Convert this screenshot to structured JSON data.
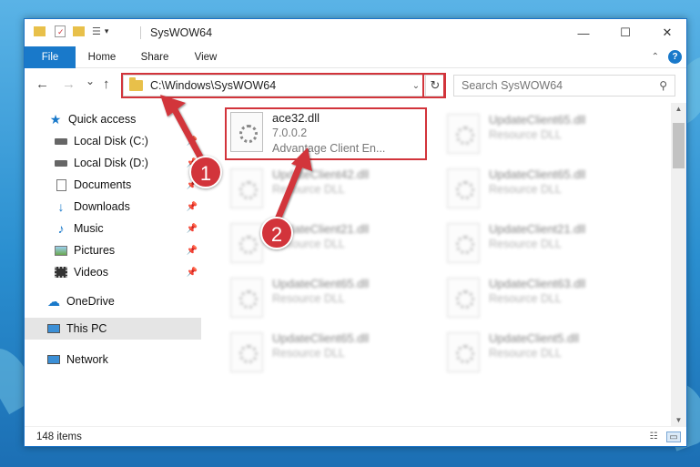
{
  "window": {
    "title": "SysWOW64",
    "minimize_glyph": "—",
    "maximize_glyph": "☐",
    "close_glyph": "✕"
  },
  "ribbon": {
    "tabs": [
      {
        "label": "File",
        "active": true
      },
      {
        "label": "Home"
      },
      {
        "label": "Share"
      },
      {
        "label": "View"
      }
    ],
    "help_glyph": "?",
    "collapse_glyph": "⌃"
  },
  "navigation": {
    "back_glyph": "←",
    "forward_glyph": "→",
    "recent_glyph": "⌄",
    "up_glyph": "↑",
    "address_path": "C:\\Windows\\SysWOW64",
    "address_dropdown_glyph": "⌄",
    "refresh_glyph": "↻",
    "search_placeholder": "Search SysWOW64",
    "search_icon": "magnifier-icon"
  },
  "sidebar": {
    "items": [
      {
        "label": "Quick access",
        "icon": "star-icon"
      },
      {
        "label": "Local Disk (C:)",
        "icon": "drive-icon",
        "pinned": true
      },
      {
        "label": "Local Disk (D:)",
        "icon": "drive-icon",
        "pinned": true
      },
      {
        "label": "Documents",
        "icon": "documents-icon",
        "pinned": true
      },
      {
        "label": "Downloads",
        "icon": "download-icon",
        "pinned": true
      },
      {
        "label": "Music",
        "icon": "music-icon",
        "pinned": true
      },
      {
        "label": "Pictures",
        "icon": "pictures-icon",
        "pinned": true
      },
      {
        "label": "Videos",
        "icon": "videos-icon",
        "pinned": true
      },
      {
        "label": "OneDrive",
        "icon": "cloud-icon"
      },
      {
        "label": "This PC",
        "icon": "computer-icon",
        "selected": true
      },
      {
        "label": "Network",
        "icon": "network-icon"
      }
    ]
  },
  "files": {
    "left_column": [
      {
        "name": "ace32.dll",
        "line2": "7.0.0.2",
        "line3": "Advantage Client En...",
        "selected": true
      },
      {
        "name": "UpdateClient42.dll",
        "line2": "Resource DLL"
      },
      {
        "name": "UpdateClient21.dll",
        "line2": "Resource DLL"
      },
      {
        "name": "UpdateClient65.dll",
        "line2": "Resource DLL"
      },
      {
        "name": "UpdateClient65.dll",
        "line2": "Resource DLL"
      }
    ],
    "right_column": [
      {
        "name": "UpdateClient65.dll",
        "line2": "Resource DLL"
      },
      {
        "name": "UpdateClient65.dll",
        "line2": "Resource DLL"
      },
      {
        "name": "UpdateClient21.dll",
        "line2": "Resource DLL"
      },
      {
        "name": "UpdateClient63.dll",
        "line2": "Resource DLL"
      },
      {
        "name": "UpdateClient5.dll",
        "line2": "Resource DLL"
      }
    ]
  },
  "status": {
    "item_count": "148 items"
  },
  "callouts": {
    "step1": "1",
    "step2": "2"
  },
  "colors": {
    "accent": "#1979ca",
    "highlight": "#d2343b",
    "folder": "#e8c04a"
  }
}
